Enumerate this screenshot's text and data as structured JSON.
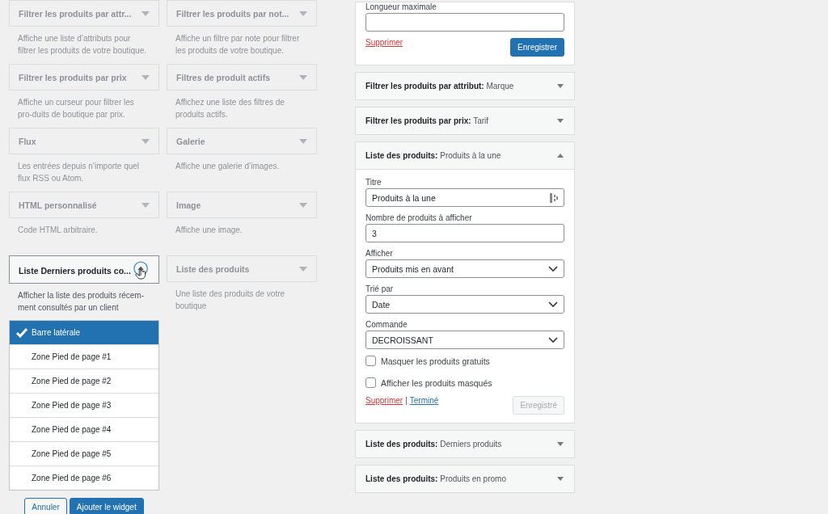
{
  "available_widgets": [
    {
      "title": "Filtrer les produits par attr...",
      "description": "Affiche une liste d’attributs pour filtrer les produits de votre boutique.",
      "dimmed": true,
      "expanded": false
    },
    {
      "title": "Filtrer les produits par not...",
      "description": "Affiche un filtre par note pour filtrer les produits de votre boutique.",
      "dimmed": true,
      "expanded": false
    },
    {
      "title": "Filtrer les produits par prix",
      "description": "Affiche un curseur pour filtrer les pro-duits de boutique par prix.",
      "dimmed": true,
      "expanded": false
    },
    {
      "title": "Filtres de produit actifs",
      "description": "Affichez une liste des filtres de produits actifs.",
      "dimmed": true,
      "expanded": false
    },
    {
      "title": "Flux",
      "description": "Les entrées depuis n’importe quel flux RSS ou Atom.",
      "dimmed": true,
      "expanded": false
    },
    {
      "title": "Galerie",
      "description": "Affiche une galerie d’images.",
      "dimmed": true,
      "expanded": false
    },
    {
      "title": "HTML personnalisé",
      "description": "Code HTML arbitraire.",
      "dimmed": true,
      "expanded": false
    },
    {
      "title": "Image",
      "description": "Affiche une image.",
      "dimmed": true,
      "expanded": false
    },
    {
      "title": "Liste Derniers produits co...",
      "description": "Afficher la liste des produits récem-ment consultés par un client",
      "dimmed": false,
      "expanded": true
    },
    {
      "title": "Liste des produits",
      "description": "Une liste des produits de votre boutique",
      "dimmed": true,
      "expanded": false
    }
  ],
  "area_chooser": {
    "areas": [
      {
        "label": "Barre latérale",
        "selected": true
      },
      {
        "label": "Zone Pied de page #1",
        "selected": false
      },
      {
        "label": "Zone Pied de page #2",
        "selected": false
      },
      {
        "label": "Zone Pied de page #3",
        "selected": false
      },
      {
        "label": "Zone Pied de page #4",
        "selected": false
      },
      {
        "label": "Zone Pied de page #5",
        "selected": false
      },
      {
        "label": "Zone Pied de page #6",
        "selected": false
      }
    ],
    "cancel": "Annuler",
    "add": "Ajouter le widget"
  },
  "sidebar_widgets": [
    {
      "kind": "form",
      "fields": [
        {
          "kind": "text",
          "label": "Longueur maximale"
        }
      ],
      "delete": "Supprimer",
      "save": {
        "label": "Enregistrer",
        "disabled": false
      }
    },
    {
      "kind": "header",
      "widget": "Filtrer les produits par attribut:",
      "title": "Marque",
      "expanded": false
    },
    {
      "kind": "header",
      "widget": "Filtrer les produits par prix:",
      "title": "Tarif",
      "expanded": false
    },
    {
      "kind": "full",
      "widget": "Liste des produits:",
      "title": "Produits à la une",
      "expanded": true,
      "fields": [
        {
          "kind": "text",
          "label": "Titre",
          "value": "Produits à la une"
        },
        {
          "kind": "text",
          "label": "Nombre de produits à afficher",
          "value": "3"
        },
        {
          "kind": "select",
          "label": "Afficher",
          "value": "Produits mis en avant"
        },
        {
          "kind": "select",
          "label": "Trié par",
          "value": "Date"
        },
        {
          "kind": "select",
          "label": "Commande",
          "value": "DECROISSANT"
        }
      ],
      "checkboxes": [
        {
          "label": "Masquer les produits gratuits",
          "checked": false
        },
        {
          "label": "Afficher les produits masqués",
          "checked": false
        }
      ],
      "delete": "Supprimer",
      "separator": "|",
      "done": "Terminé",
      "save": {
        "label": "Enregistré",
        "disabled": true
      }
    },
    {
      "kind": "header",
      "widget": "Liste des produits:",
      "title": "Derniers produits",
      "expanded": false
    },
    {
      "kind": "header",
      "widget": "Liste des produits:",
      "title": "Produits en promo",
      "expanded": false
    }
  ]
}
